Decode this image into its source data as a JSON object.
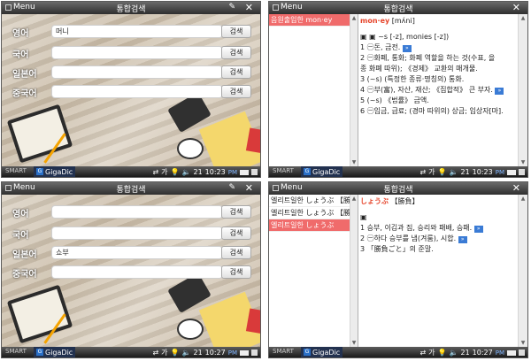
{
  "titlebar": {
    "menu": "Menu",
    "title": "통합검색",
    "close": "✕"
  },
  "taskbar": {
    "smart": "SMART",
    "app": "GigaDic",
    "lang": "가",
    "vol": "21",
    "pm": "PM"
  },
  "search": {
    "button": "검색",
    "labels": [
      "영어",
      "국어",
      "일본어",
      "중국어"
    ]
  },
  "panel1": {
    "time": "10:23",
    "values": [
      "머니",
      "",
      "",
      ""
    ]
  },
  "panel3": {
    "time": "10:27",
    "values": [
      "",
      "",
      "쇼부",
      ""
    ]
  },
  "panel2": {
    "time": "10:23",
    "list": [
      "음원출입한 mon·ey"
    ],
    "headword": "mon·ey",
    "pron": "[mʌ́ni]",
    "lines": [
      "▣ ▣ ~s [-z], monies [-z])",
      "1 ㊀돈, 금전.",
      "2 ㊀화폐, 통화; 화폐 역할을 하는 것(수표, 을",
      "   종 화폐 따위); 《경제》 교환의 매개물.",
      "3 (~s) (특정한 종류·명칭의) 통화.",
      "4 ㊀부(富), 자산, 재산; 《집합적》 큰 부자.",
      "5 (~s) 《법률》 금액.",
      "6 ㊀임금, 급료; (경마 따위의) 상금; 입상자[마]."
    ]
  },
  "panel4": {
    "time": "10:27",
    "list": [
      "엘리트일한 しょうぶ 【勝",
      "엘리트일한 しょうぶ 【勝",
      "엘리트일한 しょうぶ"
    ],
    "headword": "しょうぶ",
    "bracket": "【勝負】",
    "lines": [
      "▣",
      "1 승부, 이김과 짐, 승리와 패배, 승패.",
      "2 ㊀하다 승부를 냄(겨룸), 시합.",
      "3 「勝負ごと」의 준말."
    ]
  }
}
